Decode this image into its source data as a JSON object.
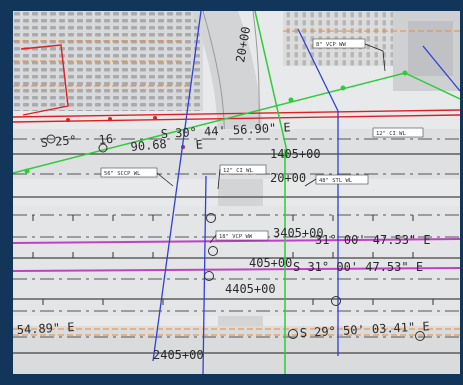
{
  "stations": {
    "top_vertical": "20+00",
    "center_1": "1405+00",
    "center_2": "20+00",
    "center_3": "3405+00",
    "center_4": "405+00",
    "center_5": "4405+00",
    "bottom": "2405+00"
  },
  "bearings": {
    "upper_left_1": "S 25°",
    "upper_left_2": "16",
    "upper_left_3": "90.68",
    "upper_left_4": "E",
    "upper_right": "S 30° 44' 56.90\" E",
    "middle_1": "31° 00' 47.53\" E",
    "middle_2": "S 31° 00' 47.53\" E",
    "lower_left": "54.89\" E",
    "lower_right": "S 29° 50' 03.41\" E"
  },
  "pipe_labels": {
    "vcp_top": "8\" VCP WW",
    "ci_right": "12\" CI WL",
    "sccp": "56\" SCCP WL",
    "ci_mid": "12\" CI WL",
    "stl": "48\" STL WL",
    "vcp_mid": "18\" VCP WW"
  },
  "colors": {
    "water_line": "#2ecc3a",
    "sewer_line": "#3040d8",
    "boundary": "#e02020",
    "magenta_line": "#c040c8",
    "orange_line": "#f08a30"
  }
}
